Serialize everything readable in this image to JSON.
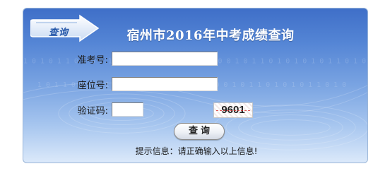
{
  "header": {
    "logo_text": "查询",
    "title": "宿州市2016年中考成绩查询"
  },
  "form": {
    "exam_number": {
      "label": "准考号:",
      "value": "",
      "placeholder": ""
    },
    "seat_number": {
      "label": "座位号:",
      "value": "",
      "placeholder": ""
    },
    "verify_code": {
      "label": "验证码:",
      "value": "",
      "placeholder": ""
    },
    "captcha_text": "9601",
    "query_button_label": "查询"
  },
  "hint": "提示信息：请正确输入以上信息!",
  "colors": {
    "panel_top": "#3f6fc8",
    "panel_bottom": "#dbe9fa",
    "title_text": "#ffffff",
    "captcha_strike": "#d63030"
  },
  "icons": [
    "arrow-badge-icon"
  ]
}
